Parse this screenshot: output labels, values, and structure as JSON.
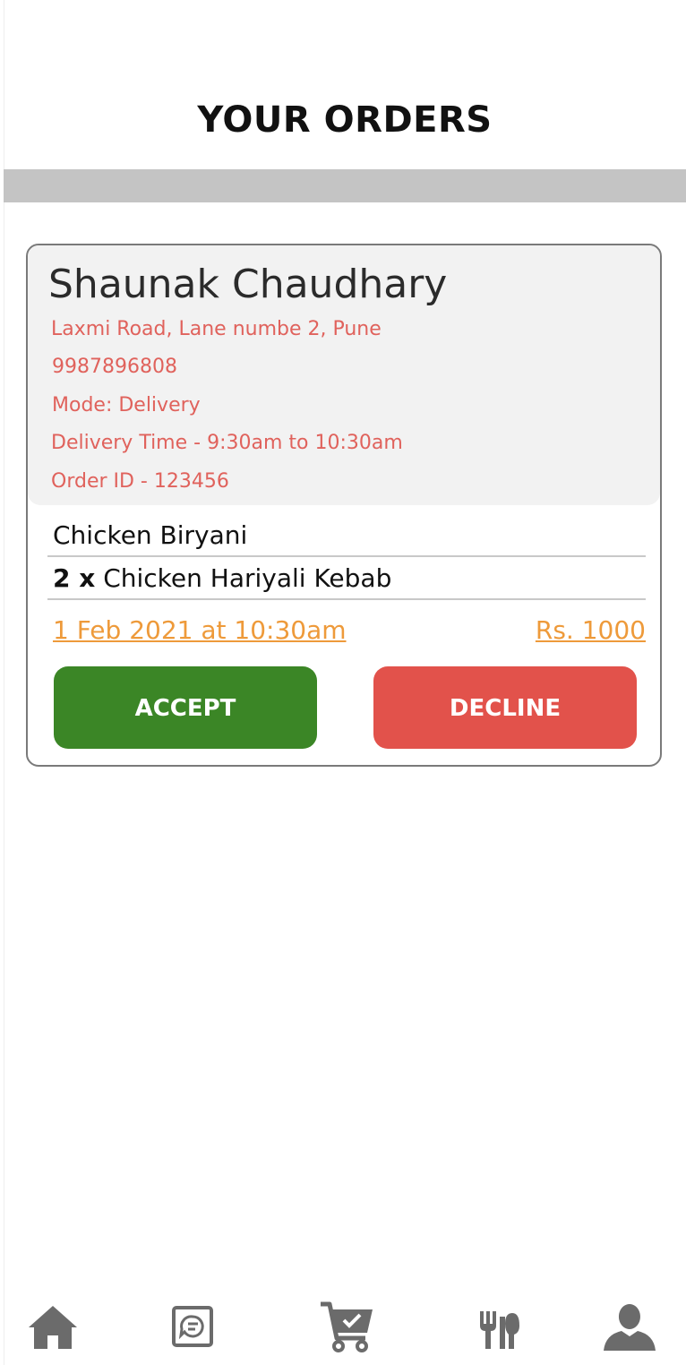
{
  "header": {
    "title": "YOUR ORDERS"
  },
  "order": {
    "customer_name": "Shaunak Chaudhary",
    "address": "Laxmi Road, Lane numbe 2, Pune",
    "phone": "9987896808",
    "mode": "Mode: Delivery",
    "delivery_time": "Delivery Time - 9:30am to 10:30am",
    "order_id": "Order ID - 123456",
    "items": [
      {
        "qty": "",
        "name": "Chicken Biryani"
      },
      {
        "qty": "2 x",
        "name": "Chicken Hariyali Kebab"
      }
    ],
    "date": "1 Feb 2021 at 10:30am",
    "total": "Rs. 1000",
    "accept_label": "ACCEPT",
    "decline_label": "DECLINE"
  },
  "nav": {
    "items": [
      {
        "icon": "home-icon"
      },
      {
        "icon": "chat-icon"
      },
      {
        "icon": "cart-check-icon"
      },
      {
        "icon": "utensils-icon"
      },
      {
        "icon": "user-icon"
      }
    ]
  },
  "colors": {
    "accept": "#3b8626",
    "decline": "#e2524b",
    "detail_text": "#e0625c",
    "meta_text": "#ee9a3a",
    "band": "#c4c4c4",
    "icon": "#6b6b6b"
  }
}
